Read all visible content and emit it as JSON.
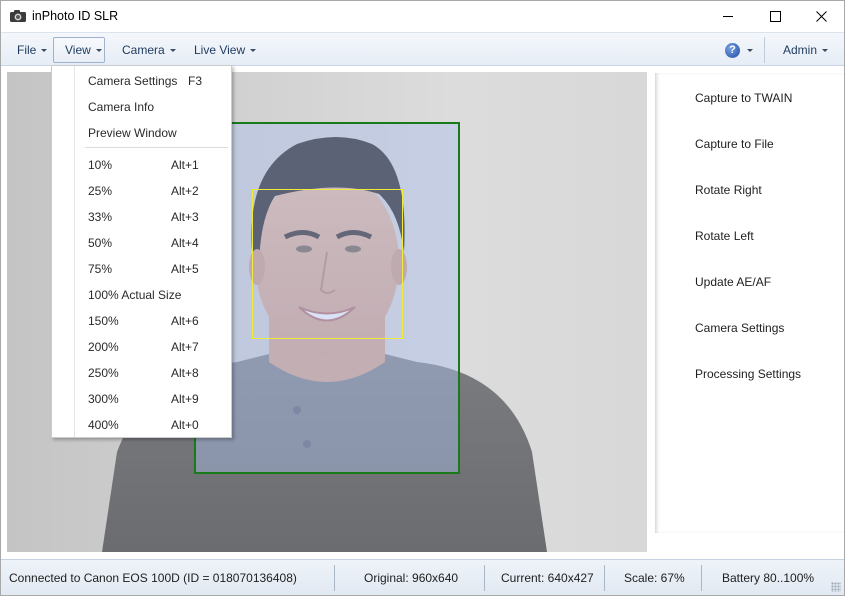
{
  "window": {
    "title": "inPhoto ID SLR",
    "app_icon": "camera-icon",
    "controls": {
      "minimize": "minimize-icon",
      "maximize": "maximize-icon",
      "close": "close-icon"
    }
  },
  "menubar": {
    "items": [
      {
        "label": "File"
      },
      {
        "label": "View",
        "active": true
      },
      {
        "label": "Camera"
      },
      {
        "label": "Live View"
      }
    ],
    "help_icon": "?",
    "user_label": "Admin"
  },
  "view_menu": {
    "items": [
      {
        "label": "Camera Settings",
        "shortcut": "F3"
      },
      {
        "label": "Camera Info",
        "shortcut": ""
      },
      {
        "label": "Preview Window",
        "shortcut": ""
      },
      {
        "label": "10%",
        "shortcut": "Alt+1"
      },
      {
        "label": "25%",
        "shortcut": "Alt+2"
      },
      {
        "label": "33%",
        "shortcut": "Alt+3"
      },
      {
        "label": "50%",
        "shortcut": "Alt+4"
      },
      {
        "label": "75%",
        "shortcut": "Alt+5"
      },
      {
        "label": "100% Actual Size",
        "shortcut": ""
      },
      {
        "label": "150%",
        "shortcut": "Alt+6"
      },
      {
        "label": "200%",
        "shortcut": "Alt+7"
      },
      {
        "label": "250%",
        "shortcut": "Alt+8"
      },
      {
        "label": "300%",
        "shortcut": "Alt+9"
      },
      {
        "label": "400%",
        "shortcut": "Alt+0"
      }
    ]
  },
  "preview": {
    "crop_frame_color": "#1a7a1a",
    "face_frame_color": "#f0eb3a"
  },
  "actions": [
    {
      "label": "Capture to TWAIN"
    },
    {
      "label": "Capture to File"
    },
    {
      "label": "Rotate Right"
    },
    {
      "label": "Rotate Left"
    },
    {
      "label": "Update AE/AF"
    },
    {
      "label": "Camera Settings"
    },
    {
      "label": "Processing Settings"
    }
  ],
  "statusbar": {
    "connection": "Connected to Canon EOS 100D (ID = 018070136408)",
    "original": "Original: 960x640",
    "current": "Current: 640x427",
    "scale": "Scale: 67%",
    "battery": "Battery 80..100%"
  }
}
